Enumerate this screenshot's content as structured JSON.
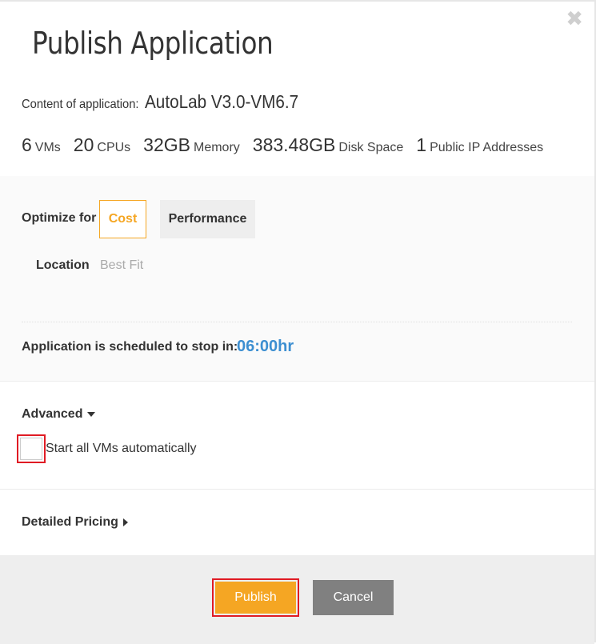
{
  "dialog": {
    "title": "Publish Application",
    "close_icon": "close-icon"
  },
  "content": {
    "label": "Content of application:",
    "app_name": "AutoLab V3.0-VM6.7"
  },
  "stats": [
    {
      "num": "6",
      "unit": "VMs"
    },
    {
      "num": "20",
      "unit": "CPUs"
    },
    {
      "num": "32GB",
      "unit": "Memory"
    },
    {
      "num": "383.48GB",
      "unit": "Disk Space"
    },
    {
      "num": "1",
      "unit": "Public IP Addresses"
    }
  ],
  "optimize": {
    "label": "Optimize for",
    "options": [
      "Cost",
      "Performance"
    ],
    "selected": "Cost"
  },
  "location": {
    "label": "Location",
    "value": "Best Fit"
  },
  "schedule": {
    "label": "Application is scheduled to stop in:",
    "time": "06:00hr"
  },
  "advanced": {
    "label": "Advanced",
    "start_all_label": "Start all VMs automatically",
    "start_all_checked": false
  },
  "pricing": {
    "label": "Detailed Pricing"
  },
  "footer": {
    "publish_label": "Publish",
    "cancel_label": "Cancel"
  },
  "colors": {
    "accent": "#f5a623",
    "time": "#3d8fd1",
    "highlight": "#e01b24",
    "cancel": "#808080"
  }
}
